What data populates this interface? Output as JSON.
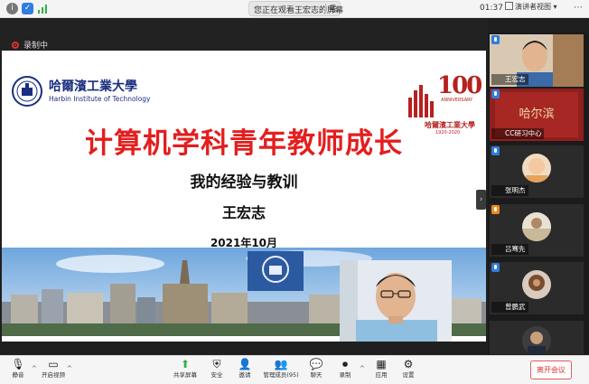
{
  "topbar": {
    "speaking_status": "您正在观看王宏志的屏幕",
    "speaking_menu": "号",
    "meeting_time": "01:37",
    "gallery_view_label": "演讲者视图",
    "more": "⋯"
  },
  "recording": {
    "label": "录制中"
  },
  "slide": {
    "logo_cn": "哈爾濱工業大學",
    "logo_en": "Harbin Institute of Technology",
    "anniv_number": "100",
    "anniv_sub": "ANNIVERSARY",
    "anniv_cn": "哈爾濱工業大學",
    "anniv_years": "1920-2020",
    "title": "计算机学科青年教师成长",
    "subtitle": "我的经验与教训",
    "author": "王宏志",
    "date": "2021年10月"
  },
  "participants": [
    {
      "name": "王宏志",
      "mic": "blue"
    },
    {
      "name": "CC研习中心",
      "mic": "blue"
    },
    {
      "name": "张明杰",
      "mic": "blue"
    },
    {
      "name": "吕骞先",
      "mic": "orange"
    },
    {
      "name": "曾鹏武",
      "mic": "blue"
    },
    {
      "name": "",
      "mic": "none"
    }
  ],
  "side_banner_text": "哈尔滨",
  "toolbar": {
    "mute": "静音",
    "video": "开启视频",
    "share": "共享屏幕",
    "security": "安全",
    "participants": "邀请",
    "members": "管理成员(95)",
    "chat": "聊天",
    "record": "录制",
    "apps": "应用",
    "settings": "设置",
    "leave": "离开会议"
  },
  "colors": {
    "title_red": "#e41e1e",
    "hit_blue": "#1b2f80",
    "leave_red": "#e03030",
    "mic_blue": "#2f7de1",
    "mic_orange": "#f08a1c"
  }
}
